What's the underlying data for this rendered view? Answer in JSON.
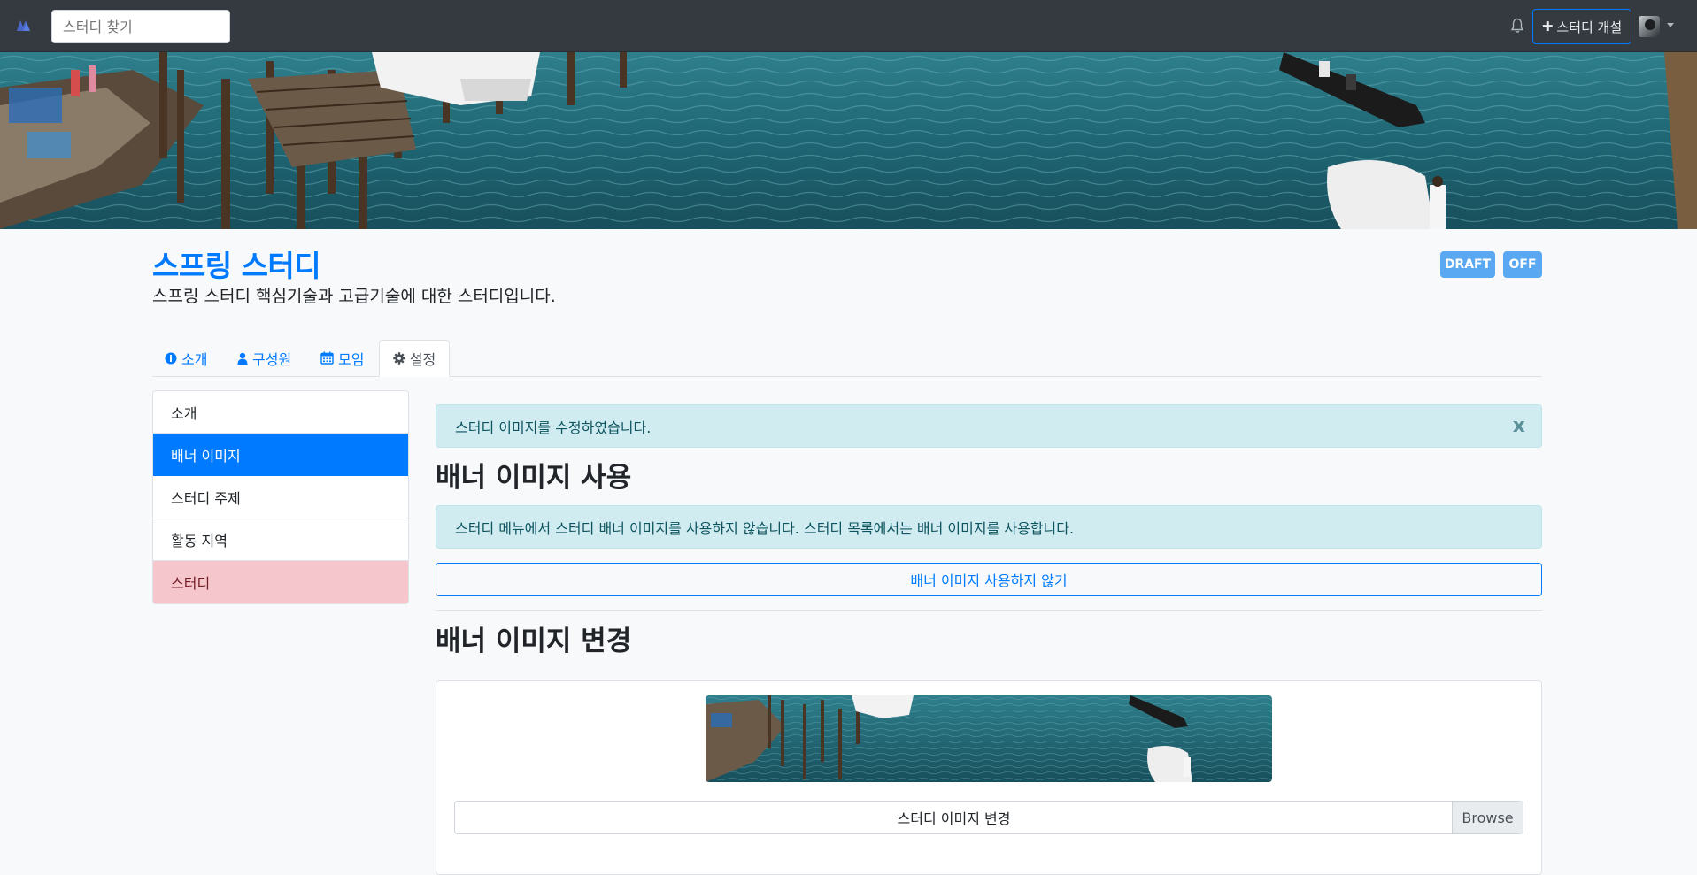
{
  "navbar": {
    "search_placeholder": "스터디 찾기",
    "create_label": "스터디 개설"
  },
  "study": {
    "title": "스프링 스터디",
    "description": "스프링 스터디 핵심기술과 고급기술에 대한 스터디입니다.",
    "badges": [
      "DRAFT",
      "OFF"
    ]
  },
  "tabs": [
    {
      "label": "소개",
      "icon": "info-circle-icon"
    },
    {
      "label": "구성원",
      "icon": "user-icon"
    },
    {
      "label": "모임",
      "icon": "calendar-icon"
    },
    {
      "label": "설정",
      "icon": "gear-icon",
      "active": true
    }
  ],
  "settings_menu": [
    {
      "label": "소개"
    },
    {
      "label": "배너 이미지",
      "active": true
    },
    {
      "label": "스터디 주제"
    },
    {
      "label": "활동 지역"
    },
    {
      "label": "스터디",
      "danger": true
    }
  ],
  "alerts": {
    "success": "스터디 이미지를 수정하였습니다.",
    "close_label": "x",
    "info": "스터디 메뉴에서 스터디 배너 이미지를 사용하지 않습니다. 스터디 목록에서는 배너 이미지를 사용합니다."
  },
  "sections": {
    "use_banner_title": "배너 이미지 사용",
    "disable_banner_button": "배너 이미지 사용하지 않기",
    "change_banner_title": "배너 이미지 변경",
    "file_label": "스터디 이미지 변경",
    "browse_label": "Browse"
  },
  "colors": {
    "primary": "#007bff",
    "navbar_bg": "#343a40",
    "badge_bg": "#5aa7f2",
    "alert_info_bg": "#d1ecf1",
    "danger_bg": "#f5c6cb"
  }
}
